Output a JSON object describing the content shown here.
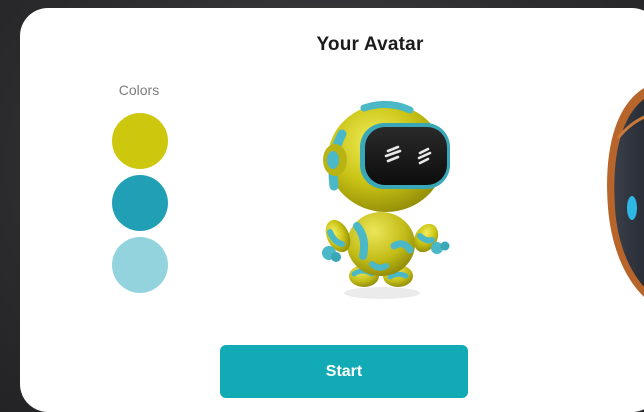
{
  "header": {
    "title": "Your Avatar"
  },
  "colors": {
    "label": "Colors",
    "swatches": [
      {
        "name": "yellow",
        "hex": "#cdc80d"
      },
      {
        "name": "teal",
        "hex": "#21a0b5"
      },
      {
        "name": "light-blue",
        "hex": "#93d3de"
      }
    ]
  },
  "start_button": {
    "label": "Start",
    "color": "#12aab4"
  },
  "avatars": [
    {
      "icon": "robot-avatar-icon",
      "selected": true
    },
    {
      "icon": "robot-avatar-icon-alt",
      "selected": false
    }
  ]
}
